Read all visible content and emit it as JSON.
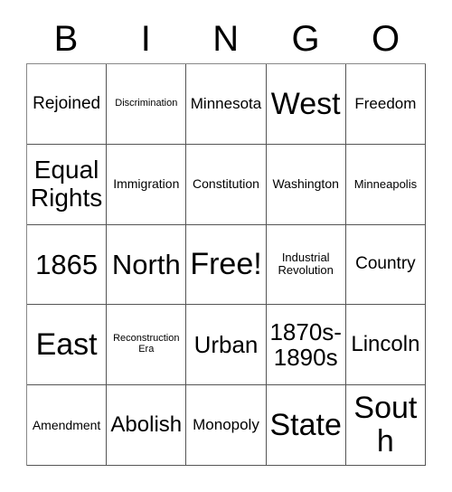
{
  "header": {
    "letters": [
      "B",
      "I",
      "N",
      "G",
      "O"
    ]
  },
  "colors": {
    "background": "#ffffff",
    "cell_background": "#ffffff",
    "grid_line": "#555555",
    "text": "#000000"
  },
  "grid": {
    "columns": 5,
    "rows": 5,
    "free_space_label": "Free!",
    "cells": [
      [
        {
          "text": "Rejoined",
          "size": "sz-l"
        },
        {
          "text": "Discrimination",
          "size": "sz-xs"
        },
        {
          "text": "Minnesota",
          "size": "sz-ml"
        },
        {
          "text": "West",
          "size": "sz-h3"
        },
        {
          "text": "Freedom",
          "size": "sz-ml"
        }
      ],
      [
        {
          "text": "Equal Rights",
          "size": "sz-h1"
        },
        {
          "text": "Immigration",
          "size": "sz-sm"
        },
        {
          "text": "Constitution",
          "size": "sz-sm"
        },
        {
          "text": "Washington",
          "size": "sz-sm"
        },
        {
          "text": "Minneapolis",
          "size": "sz-s"
        }
      ],
      [
        {
          "text": "1865",
          "size": "sz-h2"
        },
        {
          "text": "North",
          "size": "sz-h2"
        },
        {
          "text": "Free!",
          "size": "sz-h3"
        },
        {
          "text": "Industrial Revolution",
          "size": "sz-s"
        },
        {
          "text": "Country",
          "size": "sz-l"
        }
      ],
      [
        {
          "text": "East",
          "size": "sz-h3"
        },
        {
          "text": "Reconstruction Era",
          "size": "sz-xs"
        },
        {
          "text": "Urban",
          "size": "sz-xxl"
        },
        {
          "text": "1870s-1890s",
          "size": "sz-xxl"
        },
        {
          "text": "Lincoln",
          "size": "sz-xl"
        }
      ],
      [
        {
          "text": "Amendment",
          "size": "sz-sm"
        },
        {
          "text": "Abolish",
          "size": "sz-xl"
        },
        {
          "text": "Monopoly",
          "size": "sz-ml"
        },
        {
          "text": "State",
          "size": "sz-h3"
        },
        {
          "text": "South",
          "size": "sz-h3"
        }
      ]
    ]
  }
}
